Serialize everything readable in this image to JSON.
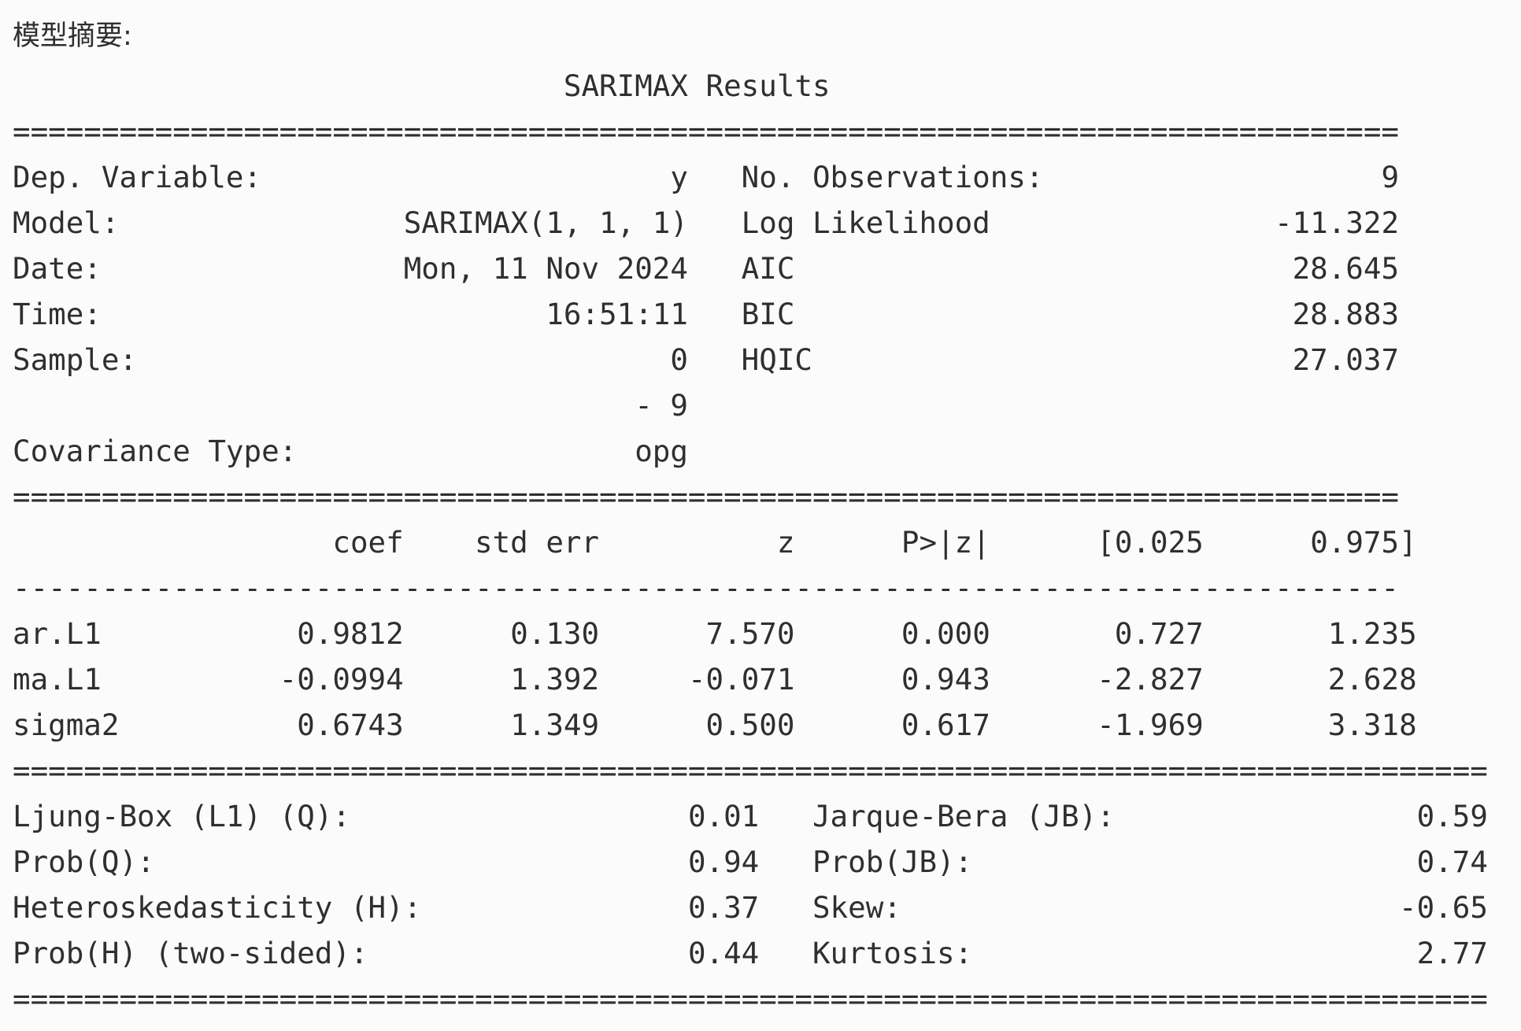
{
  "caption": "模型摘要:",
  "title": "SARIMAX Results",
  "rules": {
    "double_short": "==============================================================================",
    "dash_short": "------------------------------------------------------------------------------",
    "double_long": "==================================================================================="
  },
  "info_left": [
    {
      "label": "Dep. Variable:",
      "value": "y"
    },
    {
      "label": "Model:",
      "value": "SARIMAX(1, 1, 1)"
    },
    {
      "label": "Date:",
      "value": "Mon, 11 Nov 2024"
    },
    {
      "label": "Time:",
      "value": "16:51:11"
    },
    {
      "label": "Sample:",
      "value": "0"
    },
    {
      "label": "",
      "value": "- 9"
    },
    {
      "label": "Covariance Type:",
      "value": "opg"
    }
  ],
  "info_right": [
    {
      "label": "No. Observations:",
      "value": "9"
    },
    {
      "label": "Log Likelihood",
      "value": "-11.322"
    },
    {
      "label": "AIC",
      "value": "28.645"
    },
    {
      "label": "BIC",
      "value": "28.883"
    },
    {
      "label": "HQIC",
      "value": "27.037"
    }
  ],
  "coef_table": {
    "headers": [
      "",
      "coef",
      "std err",
      "z",
      "P>|z|",
      "[0.025",
      "0.975]"
    ],
    "rows": [
      [
        "ar.L1",
        "0.9812",
        "0.130",
        "7.570",
        "0.000",
        "0.727",
        "1.235"
      ],
      [
        "ma.L1",
        "-0.0994",
        "1.392",
        "-0.071",
        "0.943",
        "-2.827",
        "2.628"
      ],
      [
        "sigma2",
        "0.6743",
        "1.349",
        "0.500",
        "0.617",
        "-1.969",
        "3.318"
      ]
    ]
  },
  "diagnostics_left": [
    {
      "label": "Ljung-Box (L1) (Q):",
      "value": "0.01"
    },
    {
      "label": "Prob(Q):",
      "value": "0.94"
    },
    {
      "label": "Heteroskedasticity (H):",
      "value": "0.37"
    },
    {
      "label": "Prob(H) (two-sided):",
      "value": "0.44"
    }
  ],
  "diagnostics_right": [
    {
      "label": "Jarque-Bera (JB):",
      "value": "0.59"
    },
    {
      "label": "Prob(JB):",
      "value": "0.74"
    },
    {
      "label": "Skew:",
      "value": "-0.65"
    },
    {
      "label": "Kurtosis:",
      "value": "2.77"
    }
  ]
}
